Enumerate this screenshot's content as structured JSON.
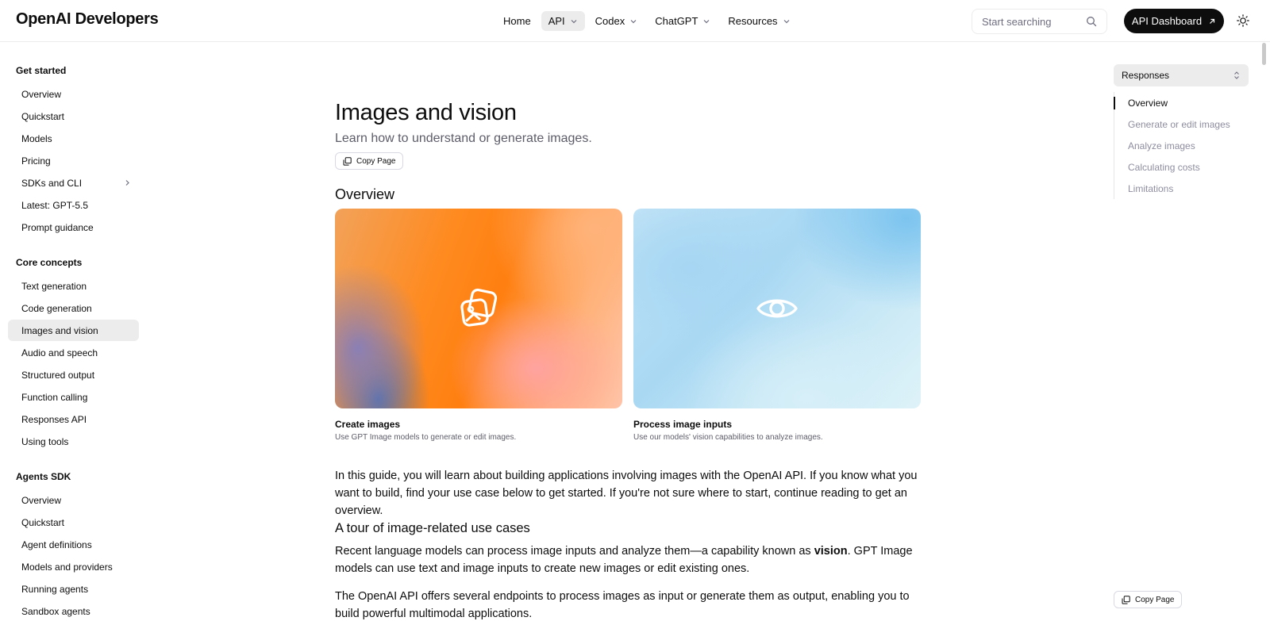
{
  "brand": {
    "logo_text": "OpenAI Developers"
  },
  "topnav": {
    "items": [
      {
        "label": "Home",
        "has_dropdown": false,
        "active": false
      },
      {
        "label": "API",
        "has_dropdown": true,
        "active": true
      },
      {
        "label": "Codex",
        "has_dropdown": true,
        "active": false
      },
      {
        "label": "ChatGPT",
        "has_dropdown": true,
        "active": false
      },
      {
        "label": "Resources",
        "has_dropdown": true,
        "active": false
      }
    ],
    "search": {
      "placeholder": "Start searching",
      "value": ""
    },
    "dashboard_button": "API Dashboard"
  },
  "sidebar": {
    "sections": [
      {
        "title": "Get started",
        "items": [
          {
            "label": "Overview"
          },
          {
            "label": "Quickstart"
          },
          {
            "label": "Models"
          },
          {
            "label": "Pricing"
          },
          {
            "label": "SDKs and CLI",
            "has_caret": true
          },
          {
            "label": "Latest: GPT-5.5"
          },
          {
            "label": "Prompt guidance"
          }
        ]
      },
      {
        "title": "Core concepts",
        "items": [
          {
            "label": "Text generation"
          },
          {
            "label": "Code generation"
          },
          {
            "label": "Images and vision",
            "active": true
          },
          {
            "label": "Audio and speech"
          },
          {
            "label": "Structured output"
          },
          {
            "label": "Function calling"
          },
          {
            "label": "Responses API"
          },
          {
            "label": "Using tools"
          }
        ]
      },
      {
        "title": "Agents SDK",
        "items": [
          {
            "label": "Overview"
          },
          {
            "label": "Quickstart"
          },
          {
            "label": "Agent definitions"
          },
          {
            "label": "Models and providers"
          },
          {
            "label": "Running agents"
          },
          {
            "label": "Sandbox agents"
          }
        ]
      }
    ]
  },
  "main": {
    "title": "Images and vision",
    "subtitle": "Learn how to understand or generate images.",
    "copy_page_label": "Copy Page",
    "overview_heading": "Overview",
    "cards": [
      {
        "title": "Create images",
        "description": "Use GPT Image models to generate or edit images.",
        "icon": "images-icon"
      },
      {
        "title": "Process image inputs",
        "description": "Use our models' vision capabilities to analyze images.",
        "icon": "eye-icon"
      }
    ],
    "intro_paragraph": "In this guide, you will learn about building applications involving images with the OpenAI API. If you know what you want to build, find your use case below to get started. If you're not sure where to start, continue reading to get an overview.",
    "tour_heading": "A tour of image-related use cases",
    "tour_p1_before": "Recent language models can process image inputs and analyze them—a capability known as ",
    "tour_p1_bold": "vision",
    "tour_p1_after": ". GPT Image models can use text and image inputs to create new images or edit existing ones.",
    "tour_p2": "The OpenAI API offers several endpoints to process images as input or generate them as output, enabling you to build powerful multimodal applications."
  },
  "toc": {
    "select_value": "Responses",
    "items": [
      {
        "label": "Overview",
        "active": true
      },
      {
        "label": "Generate or edit images"
      },
      {
        "label": "Analyze images"
      },
      {
        "label": "Calculating costs"
      },
      {
        "label": "Limitations"
      }
    ],
    "copy_page_label": "Copy Page"
  },
  "colors": {
    "text": "#0d0d0d",
    "muted": "#8e8ea0",
    "active_bg": "#ececec",
    "button_dark": "#0d0d0d"
  }
}
